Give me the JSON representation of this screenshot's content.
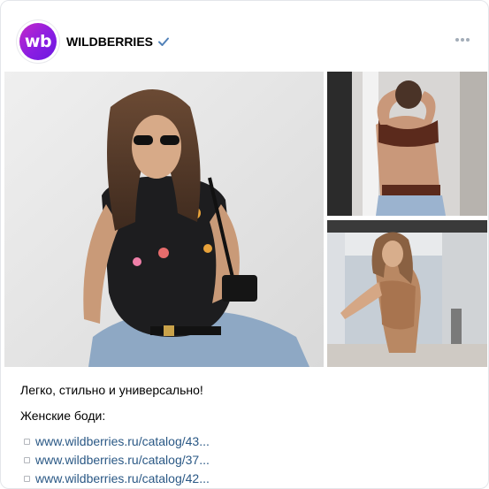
{
  "post": {
    "author": "WILDBERRIES",
    "avatar_text": "wb",
    "text_line1": "Легко, стильно и универсально!",
    "text_line2": "Женские боди:",
    "links": [
      "www.wildberries.ru/catalog/43...",
      "www.wildberries.ru/catalog/37...",
      "www.wildberries.ru/catalog/42..."
    ]
  },
  "colors": {
    "brand_gradient_start": "#c429c8",
    "brand_gradient_end": "#6a18e0",
    "link": "#2a5885",
    "verified": "#5181b8"
  },
  "icons": {
    "verified": "verified-check-icon",
    "more": "more-dots-icon",
    "bullet": "bullet-square-icon"
  }
}
